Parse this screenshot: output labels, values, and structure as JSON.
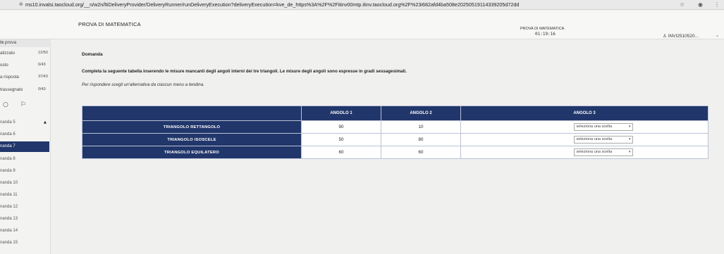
{
  "browser": {
    "url": "ms10.invalsi.taocloud.org/__n/w2n/ltiDeliveryProvider/DeliveryRunner/runDeliveryExecution?deliveryExecution=kve_de_https%3A%2F%2Fitinv00mtp.itinv.taocloud.org%2F%23i682afd4ba508e20250519114339205d72dd",
    "lock_icon": "lock-icon",
    "star_icon": "star-icon",
    "account_icon": "account-icon",
    "menu_icon": "kebab-menu-icon"
  },
  "header": {
    "title": "PROVA DI MATEMATICA",
    "timer_label": "PROVA DI MATEMATICA",
    "timer_value": "01:19:16",
    "user": "INVI2510520...",
    "user_icon": "user-icon"
  },
  "sidebar": {
    "heading": "la prova",
    "stats": [
      {
        "label": "alizzato",
        "value": "12/50"
      },
      {
        "label": "osto",
        "value": "6/43"
      },
      {
        "label": "a risposta",
        "value": "37/43"
      },
      {
        "label": "trassegnato",
        "value": "0/43"
      }
    ],
    "tools": [
      "○",
      "⚐"
    ],
    "items": [
      {
        "label": "nanda 5",
        "flag": "▲",
        "active": false
      },
      {
        "label": "nanda 6",
        "flag": "",
        "active": false
      },
      {
        "label": "nanda 7",
        "flag": "",
        "active": true
      },
      {
        "label": "nanda 8",
        "flag": "",
        "active": false
      },
      {
        "label": "nanda 9",
        "flag": "",
        "active": false
      },
      {
        "label": "nanda 10",
        "flag": "",
        "active": false
      },
      {
        "label": "nanda 11",
        "flag": "",
        "active": false
      },
      {
        "label": "nanda 12",
        "flag": "",
        "active": false
      },
      {
        "label": "nanda 13",
        "flag": "",
        "active": false
      },
      {
        "label": "nanda 14",
        "flag": "",
        "active": false
      },
      {
        "label": "nanda 15",
        "flag": "",
        "active": false
      }
    ]
  },
  "question": {
    "title": "Domanda",
    "text": "Completa la seguente tabella inserendo le misure mancanti degli angoli interni dei tre triangoli. Le misure degli angoli sono espresse in gradi sessagesimali.",
    "note": "Per rispondere scegli un'alternativa da ciascun menu a tendina."
  },
  "table": {
    "headers": [
      "",
      "ANGOLO 1",
      "ANGOLO 2",
      "ANGOLO 3"
    ],
    "rows": [
      {
        "name": "TRIANGOLO RETTANGOLO",
        "a1": "90",
        "a2": "10",
        "select": "seleziona una scelta"
      },
      {
        "name": "TRIANGOLO ISOSCELE",
        "a1": "50",
        "a2": "80",
        "select": "seleziona una scelta"
      },
      {
        "name": "TRIANGOLO EQUILATERO",
        "a1": "60",
        "a2": "60",
        "select": "seleziona una scelta"
      }
    ]
  },
  "colors": {
    "navy": "#21366a",
    "background": "#f0f0ef"
  }
}
